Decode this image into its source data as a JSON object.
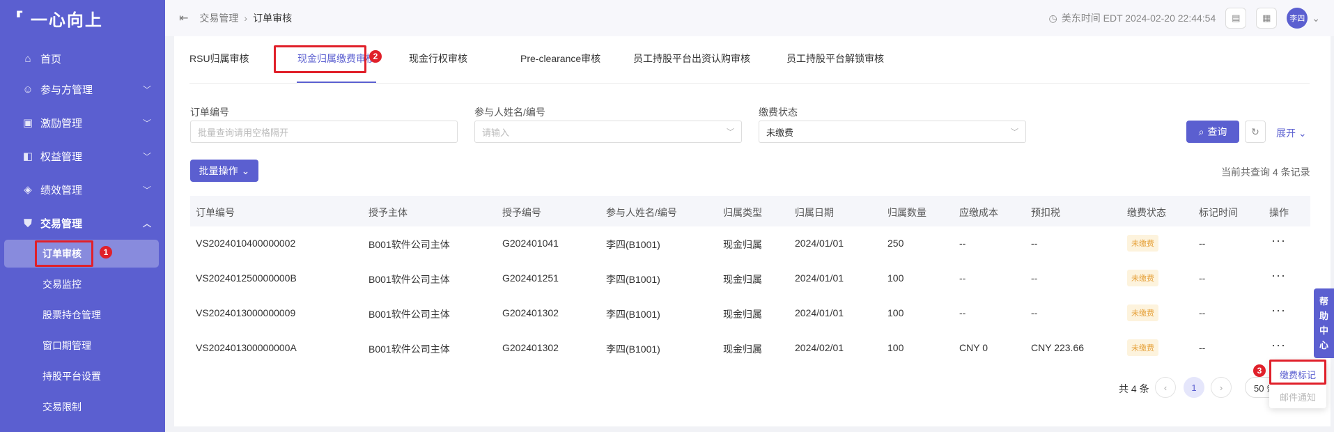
{
  "app": {
    "logo_text": "一心向上"
  },
  "sidebar": {
    "items": [
      {
        "label": "首页",
        "icon": "home-icon"
      },
      {
        "label": "参与方管理",
        "icon": "users-icon"
      },
      {
        "label": "激励管理",
        "icon": "gift-icon"
      },
      {
        "label": "权益管理",
        "icon": "equity-icon"
      },
      {
        "label": "绩效管理",
        "icon": "chart-icon"
      },
      {
        "label": "交易管理",
        "icon": "trade-icon"
      }
    ],
    "sub_items": [
      {
        "label": "订单审核",
        "active": true
      },
      {
        "label": "交易监控"
      },
      {
        "label": "股票持仓管理"
      },
      {
        "label": "窗口期管理"
      },
      {
        "label": "持股平台设置"
      },
      {
        "label": "交易限制"
      }
    ]
  },
  "header": {
    "breadcrumb": [
      "交易管理",
      "订单审核"
    ],
    "time_label": "美东时间 EDT 2024-02-20 22:44:54",
    "user_short": "李四"
  },
  "tabs": [
    {
      "label": "RSU归属审核"
    },
    {
      "label": "现金归属缴费审核",
      "active": true
    },
    {
      "label": "现金行权审核"
    },
    {
      "label": "Pre-clearance审核"
    },
    {
      "label": "员工持股平台出资认购审核"
    },
    {
      "label": "员工持股平台解锁审核"
    }
  ],
  "filters": {
    "order_no": {
      "label": "订单编号",
      "placeholder": "批量查询请用空格隔开"
    },
    "participant": {
      "label": "参与人姓名/编号",
      "placeholder": "请输入"
    },
    "status": {
      "label": "缴费状态",
      "value": "未缴费"
    },
    "search_label": "查询",
    "expand_label": "展开"
  },
  "toolbar": {
    "batch_label": "批量操作",
    "count_text": "当前共查询 4 条记录"
  },
  "table": {
    "headers": [
      "订单编号",
      "授予主体",
      "授予编号",
      "参与人姓名/编号",
      "归属类型",
      "归属日期",
      "归属数量",
      "应缴成本",
      "预扣税",
      "缴费状态",
      "标记时间",
      "操作"
    ],
    "rows": [
      [
        "VS2024010400000002",
        "B001软件公司主体",
        "G202401041",
        "李四(B1001)",
        "现金归属",
        "2024/01/01",
        "250",
        "--",
        "--",
        "未缴费",
        "--",
        "···"
      ],
      [
        "VS202401250000000B",
        "B001软件公司主体",
        "G202401251",
        "李四(B1001)",
        "现金归属",
        "2024/01/01",
        "100",
        "--",
        "--",
        "未缴费",
        "--",
        "···"
      ],
      [
        "VS2024013000000009",
        "B001软件公司主体",
        "G202401302",
        "李四(B1001)",
        "现金归属",
        "2024/01/01",
        "100",
        "--",
        "--",
        "未缴费",
        "--",
        "···"
      ],
      [
        "VS202401300000000A",
        "B001软件公司主体",
        "G202401302",
        "李四(B1001)",
        "现金归属",
        "2024/02/01",
        "100",
        "CNY 0",
        "CNY 223.66",
        "未缴费",
        "--",
        "···"
      ]
    ]
  },
  "pagination": {
    "total_text": "共 4 条",
    "current": "1",
    "page_size": "50 条/页"
  },
  "row_menu": {
    "items": [
      "缴费标记",
      "邮件通知"
    ]
  },
  "help_tab": {
    "chars": [
      "帮",
      "助",
      "中",
      "心"
    ]
  },
  "annotations": {
    "markers": [
      "1",
      "2",
      "3"
    ]
  },
  "colors": {
    "primary": "#5b5fd0",
    "highlight": "#e0202a",
    "badge_bg": "#fdf3dd",
    "badge_text": "#e6a23c"
  }
}
